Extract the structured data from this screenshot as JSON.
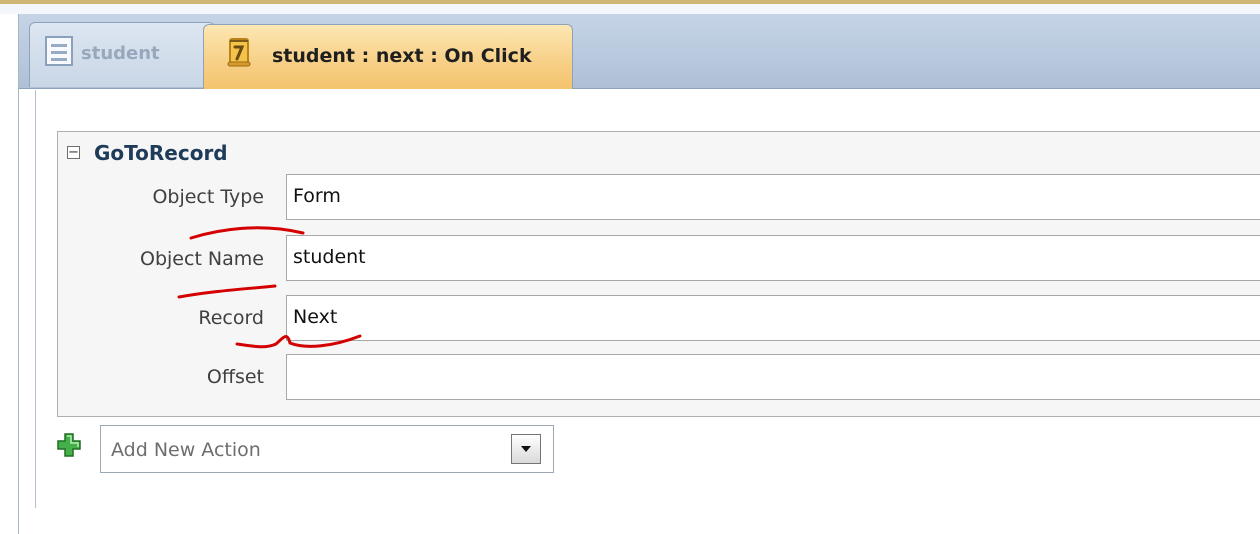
{
  "tabs": [
    {
      "label": "student",
      "icon": "form-icon",
      "active": false
    },
    {
      "label": "student : next : On Click",
      "icon": "macro-icon",
      "active": true
    }
  ],
  "action": {
    "name": "GoToRecord",
    "collapse_symbol": "−",
    "arguments": [
      {
        "label": "Object Type",
        "value": "Form"
      },
      {
        "label": "Object Name",
        "value": "student"
      },
      {
        "label": "Record",
        "value": "Next"
      },
      {
        "label": "Offset",
        "value": ""
      }
    ]
  },
  "add_action": {
    "placeholder": "Add New Action",
    "icon": "plus-icon"
  },
  "colors": {
    "active_tab": "#f7cf85",
    "tab_strip": "#b6c7dc",
    "annotation": "#d40000",
    "plus": "#3aa33a"
  }
}
